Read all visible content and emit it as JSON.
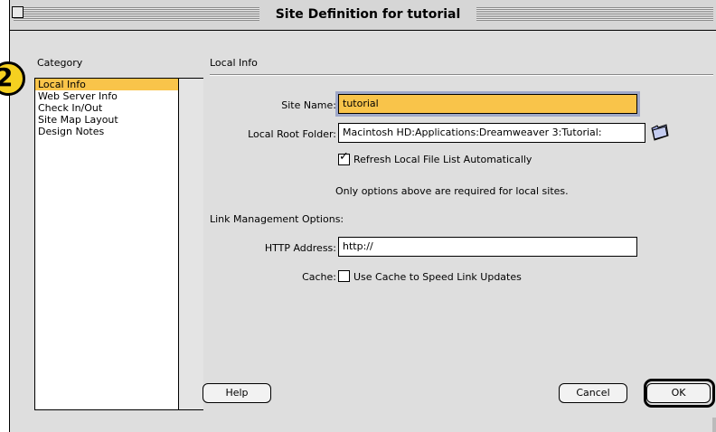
{
  "window": {
    "title": "Site Definition for tutorial"
  },
  "step_badge": "2",
  "category": {
    "label": "Category",
    "items": [
      {
        "label": "Local Info",
        "selected": true
      },
      {
        "label": "Web Server Info",
        "selected": false
      },
      {
        "label": "Check In/Out",
        "selected": false
      },
      {
        "label": "Site Map Layout",
        "selected": false
      },
      {
        "label": "Design Notes",
        "selected": false
      }
    ]
  },
  "local_info": {
    "section_title": "Local Info",
    "site_name_label": "Site Name:",
    "site_name_value": "tutorial",
    "root_folder_label": "Local Root Folder:",
    "root_folder_value": "Macintosh HD:Applications:Dreamweaver 3:Tutorial:",
    "folder_icon": "folder-icon",
    "refresh_checkbox_label": "Refresh Local File List Automatically",
    "refresh_checked": true,
    "required_note": "Only options above are required for local sites."
  },
  "link_management": {
    "section_label": "Link Management Options:",
    "http_label": "HTTP Address:",
    "http_value": "http://",
    "cache_label": "Cache:",
    "cache_checkbox_label": "Use Cache to Speed Link Updates",
    "cache_checked": false
  },
  "buttons": {
    "help": "Help",
    "cancel": "Cancel",
    "ok": "OK"
  },
  "colors": {
    "highlight": "#f9c44a",
    "badge": "#f5d020",
    "focus_ring": "#9fa8c8"
  }
}
